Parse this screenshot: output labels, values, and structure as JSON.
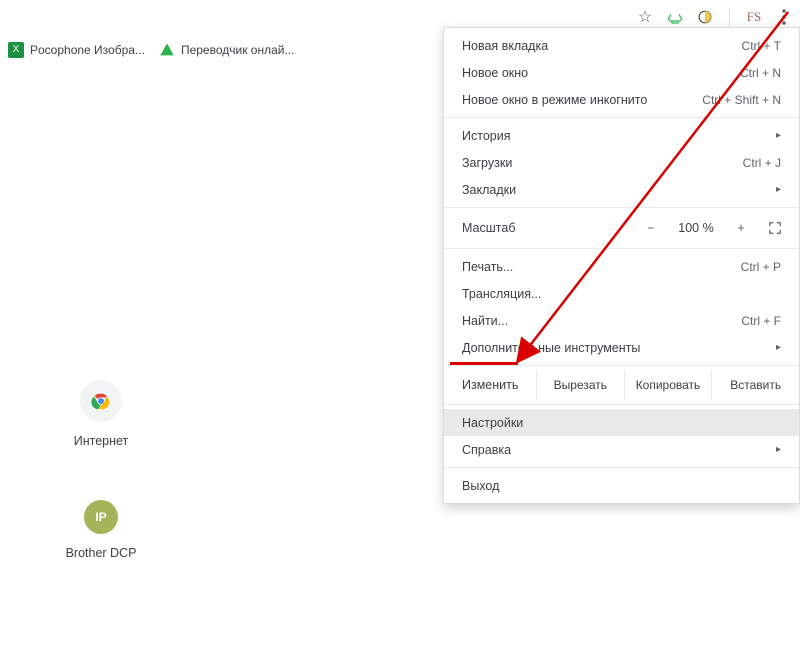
{
  "toolbar": {
    "star_tooltip": "Добавить в закладки",
    "recycle_icon": "recycle-icon",
    "ext1_icon": "ext-icon",
    "ext2_label": "FS",
    "menu_icon": "more-vert-icon"
  },
  "bookmarks": [
    {
      "label": "Pocophone Изобра...",
      "favicon": "xls"
    },
    {
      "label": "Переводчик онлай...",
      "favicon": "translate"
    }
  ],
  "shortcuts": [
    {
      "label": "Интернет",
      "icon": "chrome"
    },
    {
      "label": "Brother DCP",
      "icon": "ip",
      "ip_text": "IP"
    }
  ],
  "menu": {
    "new_tab": {
      "label": "Новая вкладка",
      "shortcut": "Ctrl + T"
    },
    "new_window": {
      "label": "Новое окно",
      "shortcut": "Ctrl + N"
    },
    "new_incognito": {
      "label": "Новое окно в режиме инкогнито",
      "shortcut": "Ctrl + Shift + N"
    },
    "history": {
      "label": "История"
    },
    "downloads": {
      "label": "Загрузки",
      "shortcut": "Ctrl + J"
    },
    "bookmarks": {
      "label": "Закладки"
    },
    "zoom": {
      "label": "Масштаб",
      "value": "100 %",
      "minus": "−",
      "plus": "+"
    },
    "print": {
      "label": "Печать...",
      "shortcut": "Ctrl + P"
    },
    "cast": {
      "label": "Трансляция..."
    },
    "find": {
      "label": "Найти...",
      "shortcut": "Ctrl + F"
    },
    "more_tools": {
      "label": "Дополнительные инструменты"
    },
    "edit": {
      "label": "Изменить",
      "cut": "Вырезать",
      "copy": "Копировать",
      "paste": "Вставить"
    },
    "settings": {
      "label": "Настройки"
    },
    "help": {
      "label": "Справка"
    },
    "exit": {
      "label": "Выход"
    }
  }
}
